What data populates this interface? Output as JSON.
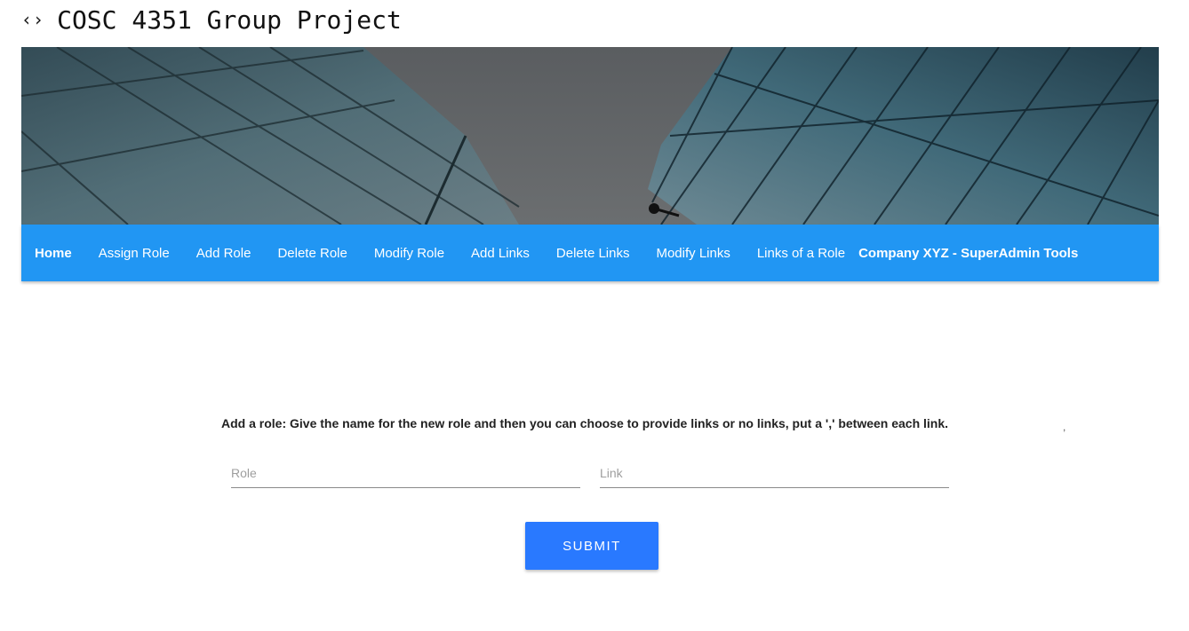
{
  "header": {
    "icon": "code-icon",
    "icon_glyph": "‹›",
    "title": "COSC 4351 Group Project"
  },
  "banner": {
    "image": "building-glass-facade"
  },
  "navbar": {
    "items": [
      {
        "label": "Home"
      },
      {
        "label": "Assign Role"
      },
      {
        "label": "Add Role"
      },
      {
        "label": "Delete Role"
      },
      {
        "label": "Modify Role"
      },
      {
        "label": "Add Links"
      },
      {
        "label": "Delete Links"
      },
      {
        "label": "Modify Links"
      },
      {
        "label": "Links of a Role"
      }
    ],
    "brand": "Company XYZ - SuperAdmin Tools",
    "color": "#2196f3"
  },
  "form": {
    "instructions": "Add a role: Give the name for the new role and then you can choose to provide links or no links, put a ',' between each link.",
    "stray_mark": ",",
    "role": {
      "placeholder": "Role",
      "value": ""
    },
    "link": {
      "placeholder": "Link",
      "value": ""
    },
    "submit_label": "SUBMIT",
    "submit_color": "#2979ff"
  }
}
